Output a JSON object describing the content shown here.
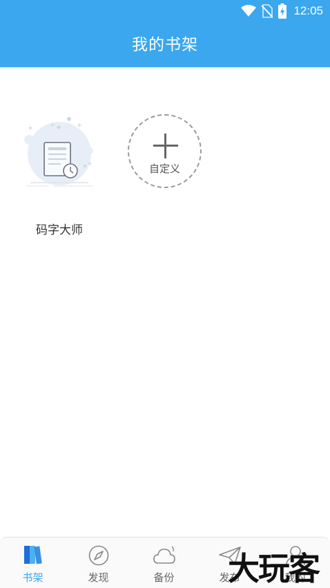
{
  "status_bar": {
    "time": "12:05",
    "icons": [
      "wifi-icon",
      "no-sim-icon",
      "battery-charging-icon"
    ]
  },
  "header": {
    "title": "我的书架",
    "background_color": "#3aa7ee"
  },
  "shelf": {
    "books": [
      {
        "title": "码字大师",
        "cover_icon": "document-clock-icon"
      }
    ],
    "add_button": {
      "label": "自定义",
      "icon": "plus-icon"
    }
  },
  "tabbar": {
    "active_color": "#3aa7ee",
    "tabs": [
      {
        "label": "书架",
        "icon": "bookshelf-icon",
        "active": true
      },
      {
        "label": "发现",
        "icon": "compass-icon",
        "active": false
      },
      {
        "label": "备份",
        "icon": "cloud-icon",
        "active": false
      },
      {
        "label": "发布",
        "icon": "paper-plane-icon",
        "active": false
      },
      {
        "label": "我的",
        "icon": "user-icon",
        "active": false
      }
    ]
  },
  "watermark": {
    "text": "大玩客"
  }
}
